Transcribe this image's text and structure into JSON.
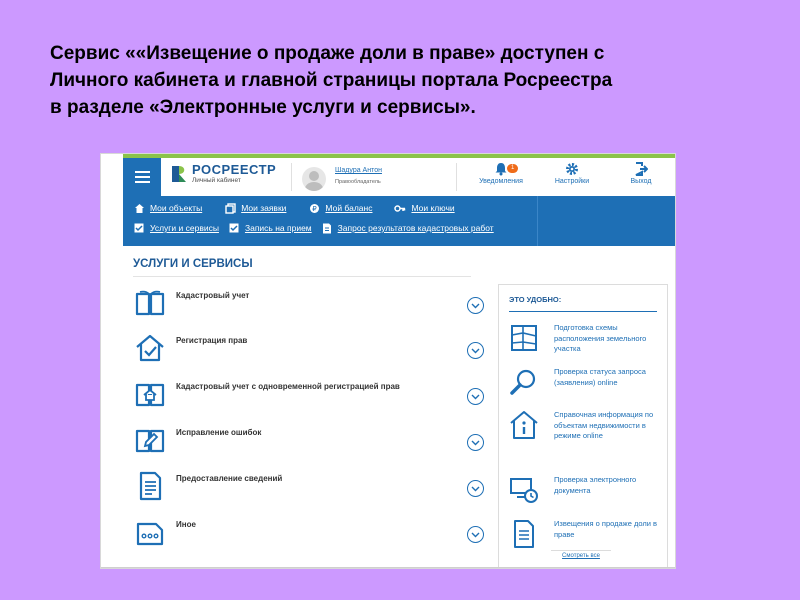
{
  "caption": {
    "line1": "Сервис ««Извещение о продаже доли в праве»  доступен с",
    "line2": "Личного кабинета и главной страницы портала Росреестра",
    "line3": "в разделе «Электронные услуги и сервисы»."
  },
  "colors": {
    "background": "#cc99ff",
    "primary": "#1e6fb5",
    "accent_green": "#8bc34a",
    "badge": "#ef6c1a"
  },
  "header": {
    "menu_icon": "hamburger-icon",
    "logo_title": "РОСРЕЕСТР",
    "logo_subtitle": "Личный кабинет",
    "user_name": "Шадура Антон",
    "user_role": "Правообладатель",
    "notifications_label": "Уведомления",
    "notifications_count": "1",
    "settings_label": "Настройки",
    "logout_label": "Выход"
  },
  "nav": {
    "row1": [
      {
        "label": "Мои объекты",
        "icon": "home-icon"
      },
      {
        "label": "Мои заявки",
        "icon": "documents-icon"
      },
      {
        "label": "Мой баланс",
        "icon": "balance-icon"
      },
      {
        "label": "Мои ключи",
        "icon": "key-icon"
      }
    ],
    "row2": [
      {
        "label": "Услуги и сервисы",
        "icon": "checkbox-icon"
      },
      {
        "label": "Запись на прием",
        "icon": "checkbox-icon"
      },
      {
        "label": "Запрос результатов кадастровых работ",
        "icon": "document-icon"
      }
    ]
  },
  "services": {
    "title": "УСЛУГИ И СЕРВИСЫ",
    "items": [
      {
        "label": "Кадастровый учет",
        "icon": "book-icon"
      },
      {
        "label": "Регистрация прав",
        "icon": "house-check-icon"
      },
      {
        "label": "Кадастровый учет с одновременной регистрацией прав",
        "icon": "book-house-icon"
      },
      {
        "label": "Исправление ошибок",
        "icon": "book-pencil-icon"
      },
      {
        "label": "Предоставление сведений",
        "icon": "document-list-icon"
      },
      {
        "label": "Иное",
        "icon": "ellipsis-document-icon"
      }
    ]
  },
  "convenient": {
    "title": "ЭТО УДОБНО:",
    "items": [
      {
        "label": "Подготовка схемы расположения земельного участка",
        "icon": "land-plot-icon"
      },
      {
        "label": "Проверка статуса запроса (заявления) online",
        "icon": "magnifier-icon"
      },
      {
        "label": "Справочная информация по объектам недвижимости в режиме online",
        "icon": "building-info-icon"
      },
      {
        "label": "Проверка электронного документа",
        "icon": "monitor-clock-icon"
      },
      {
        "label": "Извещения о продаже доли в праве",
        "icon": "document-icon"
      }
    ],
    "see_all": "Смотреть все"
  }
}
